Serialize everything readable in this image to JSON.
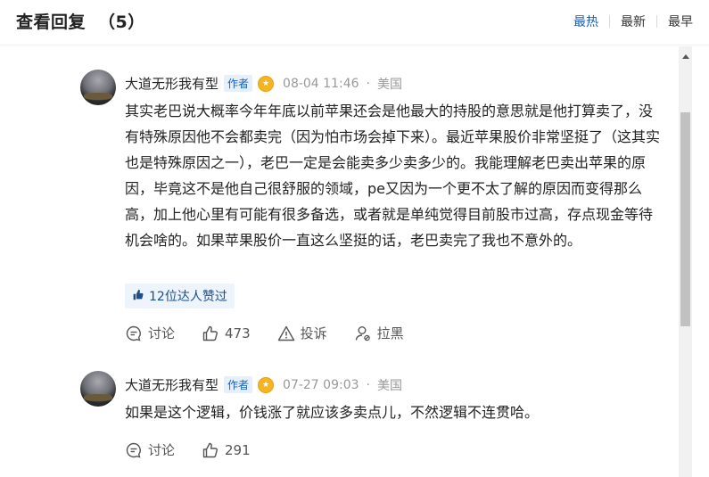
{
  "header": {
    "title": "查看回复",
    "count": "（5）",
    "sort": [
      "最热",
      "最新",
      "最早"
    ]
  },
  "comments": [
    {
      "name": "大道无形我有型",
      "tag": "作者",
      "time": "08-04 11:46",
      "location": "美国",
      "text": "其实老巴说大概率今年年底以前苹果还会是他最大的持股的意思就是他打算卖了，没有特殊原因他不会都卖完（因为怕市场会掉下来）。最近苹果股价非常坚挺了（这其实也是特殊原因之一），老巴一定是会能卖多少卖多少的。我能理解老巴卖出苹果的原因，毕竟这不是他自己很舒服的领域，pe又因为一个更不太了解的原因而变得那么高，加上他心里有可能有很多备选，或者就是单纯觉得目前股市过高，存点现金等待机会啥的。如果苹果股价一直这么坚挺的话，老巴卖完了我也不意外的。",
      "likes_label": "12位达人赞过",
      "actions": {
        "discuss": "讨论",
        "likes": "473",
        "report": "投诉",
        "block": "拉黑"
      }
    },
    {
      "name": "大道无形我有型",
      "tag": "作者",
      "time": "07-27 09:03",
      "location": "美国",
      "text": "如果是这个逻辑，价钱涨了就应该多卖点儿，不然逻辑不连贯哈。",
      "actions": {
        "discuss": "讨论",
        "likes": "291"
      }
    }
  ],
  "colors": {
    "accent": "#1a5fb4",
    "tag_bg": "#e6f0fb",
    "muted": "#999999"
  }
}
